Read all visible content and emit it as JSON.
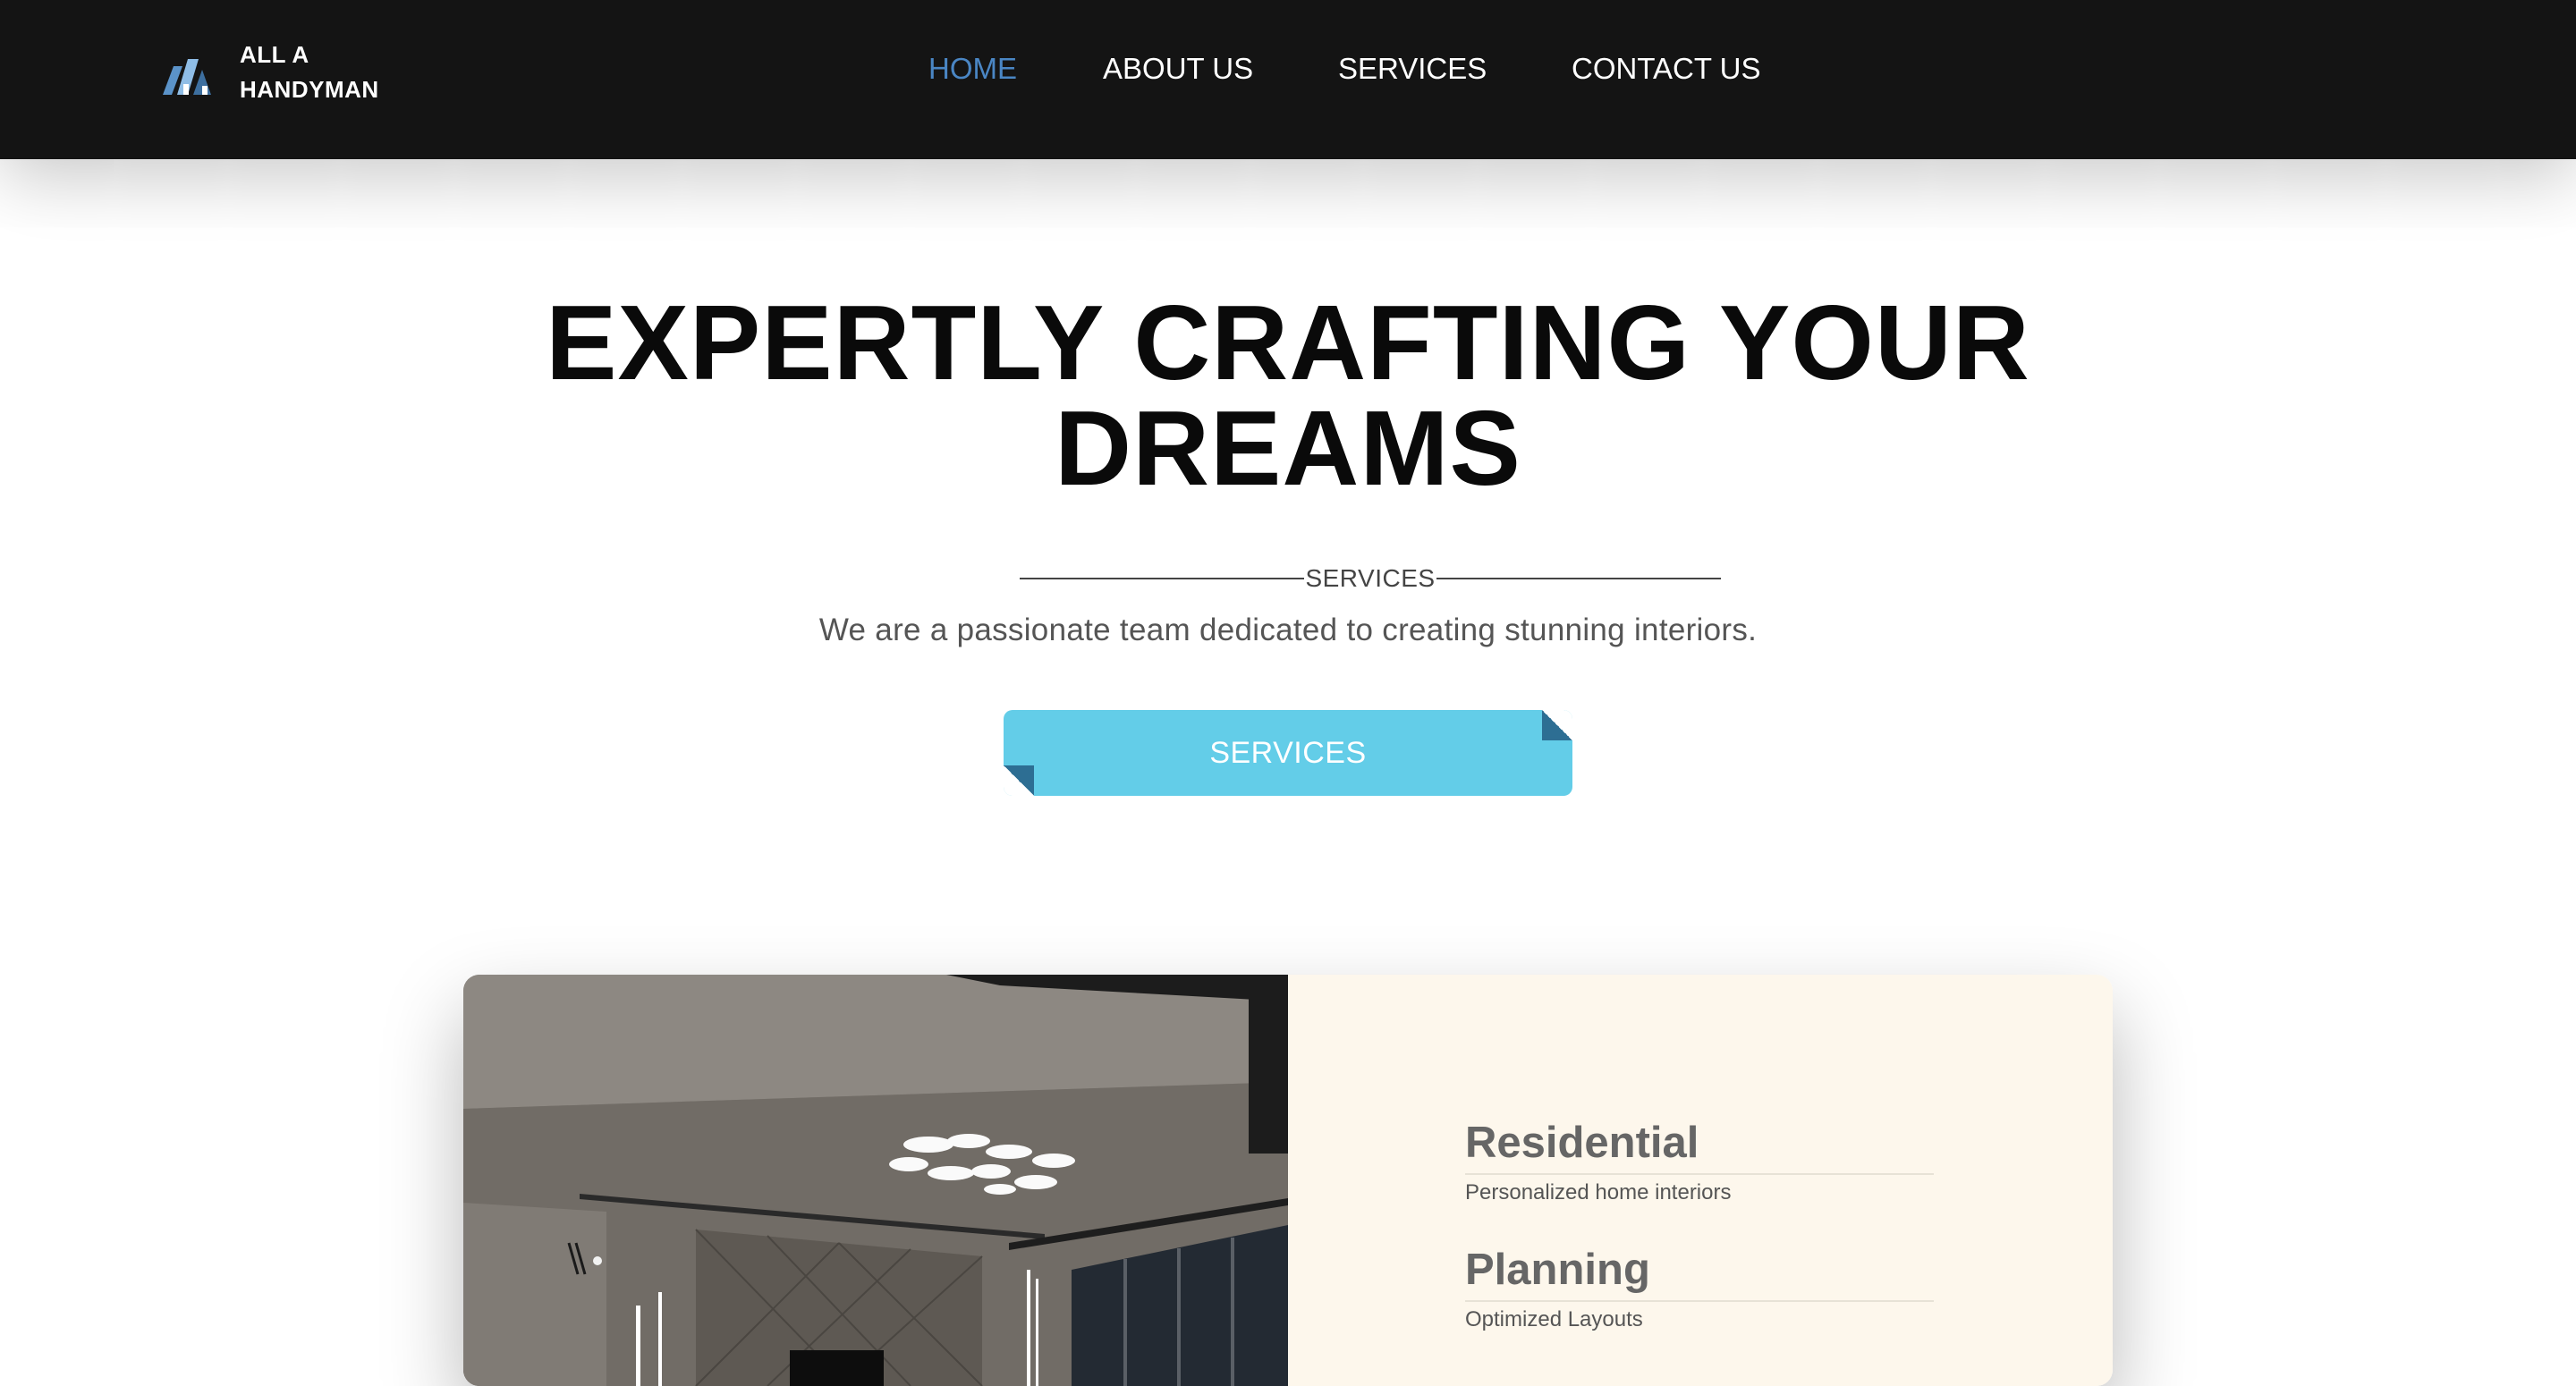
{
  "brand": {
    "line1": "ALL A",
    "line2": "HANDYMAN",
    "logo_icon": "house-logo-icon"
  },
  "nav": {
    "items": [
      {
        "label": "HOME",
        "active": true
      },
      {
        "label": "ABOUT US",
        "active": false
      },
      {
        "label": "SERVICES",
        "active": false
      },
      {
        "label": "CONTACT US",
        "active": false
      }
    ]
  },
  "hero": {
    "title_line1": "EXPERTLY CRAFTING YOUR",
    "title_line2": "DREAMS",
    "section_label": "SERVICES",
    "tagline": "We are a passionate team dedicated to creating stunning interiors.",
    "cta_label": "SERVICES"
  },
  "services": [
    {
      "title": "Residential",
      "description": "Personalized home interiors"
    },
    {
      "title": "Planning",
      "description": "Optimized Layouts"
    }
  ],
  "colors": {
    "header_bg": "#141414",
    "nav_active": "#4a86c4",
    "cta_bg": "#63cde8",
    "cta_fold": "#2d6e93",
    "panel_bg": "#fdf7ec"
  }
}
